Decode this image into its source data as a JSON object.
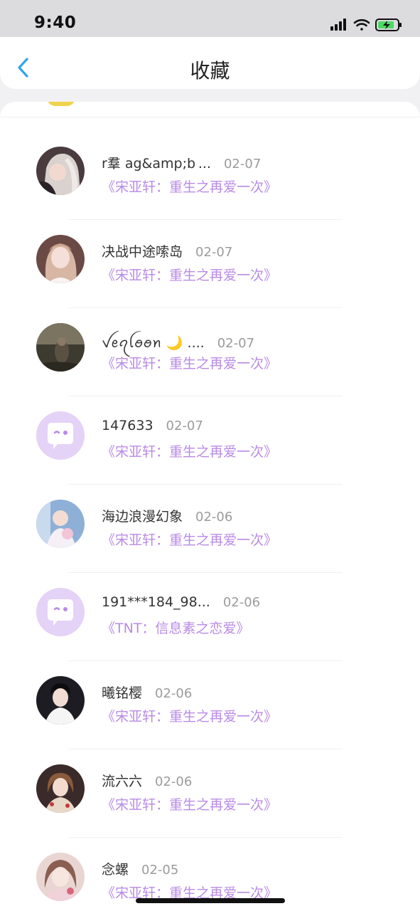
{
  "status_bar": {
    "time": "9:40"
  },
  "header": {
    "title": "收藏"
  },
  "favorites": [
    {
      "name": "r羣 ag&amp;b ...",
      "date": "02-07",
      "book": "《宋亚轩：重生之再爱一次》",
      "avatar": "photo-avatar"
    },
    {
      "name": "决战中途嗦岛",
      "date": "02-07",
      "book": "《宋亚轩：重生之再爱一次》",
      "avatar": "photo-avatar"
    },
    {
      "name": "ꪜꫀꪖꪶꪮꪮꪀ 🌙 ....",
      "date": "02-07",
      "book": "《宋亚轩：重生之再爱一次》",
      "avatar": "photo-avatar"
    },
    {
      "name": "147633",
      "date": "02-07",
      "book": "《宋亚轩：重生之再爱一次》",
      "avatar": "default-chat-avatar"
    },
    {
      "name": "海边浪漫幻象",
      "date": "02-06",
      "book": "《宋亚轩：重生之再爱一次》",
      "avatar": "photo-avatar"
    },
    {
      "name": "191***184_98...",
      "date": "02-06",
      "book": "《TNT：信息素之恋爱》",
      "avatar": "default-chat-avatar"
    },
    {
      "name": "曦铭樱",
      "date": "02-06",
      "book": "《宋亚轩：重生之再爱一次》",
      "avatar": "photo-avatar"
    },
    {
      "name": "流六六",
      "date": "02-06",
      "book": "《宋亚轩：重生之再爱一次》",
      "avatar": "photo-avatar"
    },
    {
      "name": "念螺",
      "date": "02-05",
      "book": "《宋亚轩：重生之再爱一次》",
      "avatar": "photo-avatar"
    }
  ],
  "colors": {
    "accent": "#2fa6e8",
    "book_title": "#b98be6",
    "default_avatar": "#e4d2f7"
  }
}
